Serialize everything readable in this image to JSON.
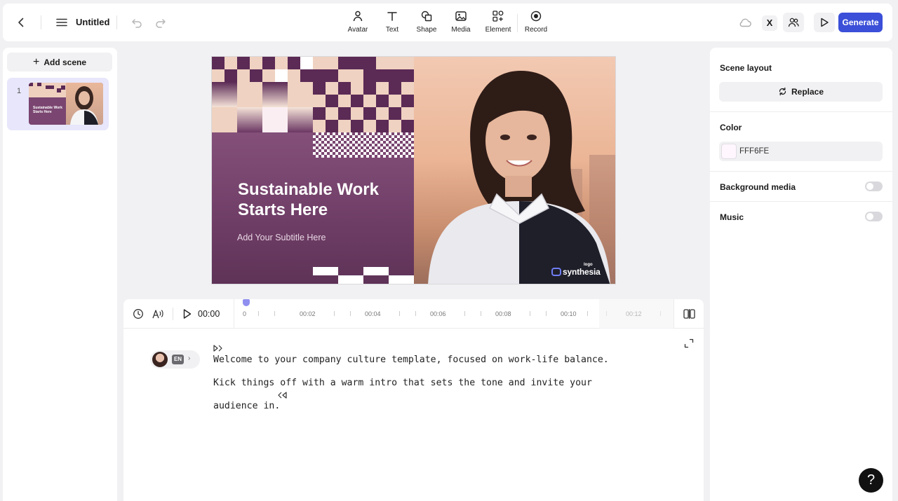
{
  "topbar": {
    "title": "Untitled",
    "tools": [
      {
        "label": "Avatar",
        "icon": "avatar-icon"
      },
      {
        "label": "Text",
        "icon": "text-icon"
      },
      {
        "label": "Shape",
        "icon": "shape-icon"
      },
      {
        "label": "Media",
        "icon": "media-icon"
      },
      {
        "label": "Element",
        "icon": "element-icon"
      },
      {
        "label": "Record",
        "icon": "record-icon"
      }
    ],
    "x_badge": "X",
    "generate_label": "Generate"
  },
  "scenes": {
    "add_label": "Add scene",
    "add_symbol": "+",
    "items": [
      {
        "number": "1",
        "thumb_title": "Sustainable Work Starts Here"
      }
    ]
  },
  "canvas": {
    "title_line1": "Sustainable Work",
    "title_line2": "Starts Here",
    "subtitle": "Add Your Subtitle Here",
    "logo_small": "logo",
    "logo_brand": "synthesia"
  },
  "timeline": {
    "current_time": "00:00",
    "marks": [
      "0",
      "00:02",
      "00:04",
      "00:06",
      "00:08",
      "00:10",
      "00:12"
    ]
  },
  "script": {
    "language": "EN",
    "chip_arrow": "›",
    "lines": [
      "Welcome to your company culture template, focused on work-life balance.",
      "Kick things off with a warm intro that sets the tone and invite your",
      "audience in."
    ]
  },
  "rightpanel": {
    "scene_layout_label": "Scene layout",
    "replace_label": "Replace",
    "color_label": "Color",
    "color_hex": "FFF6FE",
    "color_value": "#FFF6FE",
    "background_media_label": "Background media",
    "background_media_on": false,
    "music_label": "Music",
    "music_on": false
  },
  "help_label": "?",
  "colors": {
    "accent": "#3b4fd8",
    "scene_plum": "#6e3d66",
    "scene_selected": "#e7e6fb"
  }
}
